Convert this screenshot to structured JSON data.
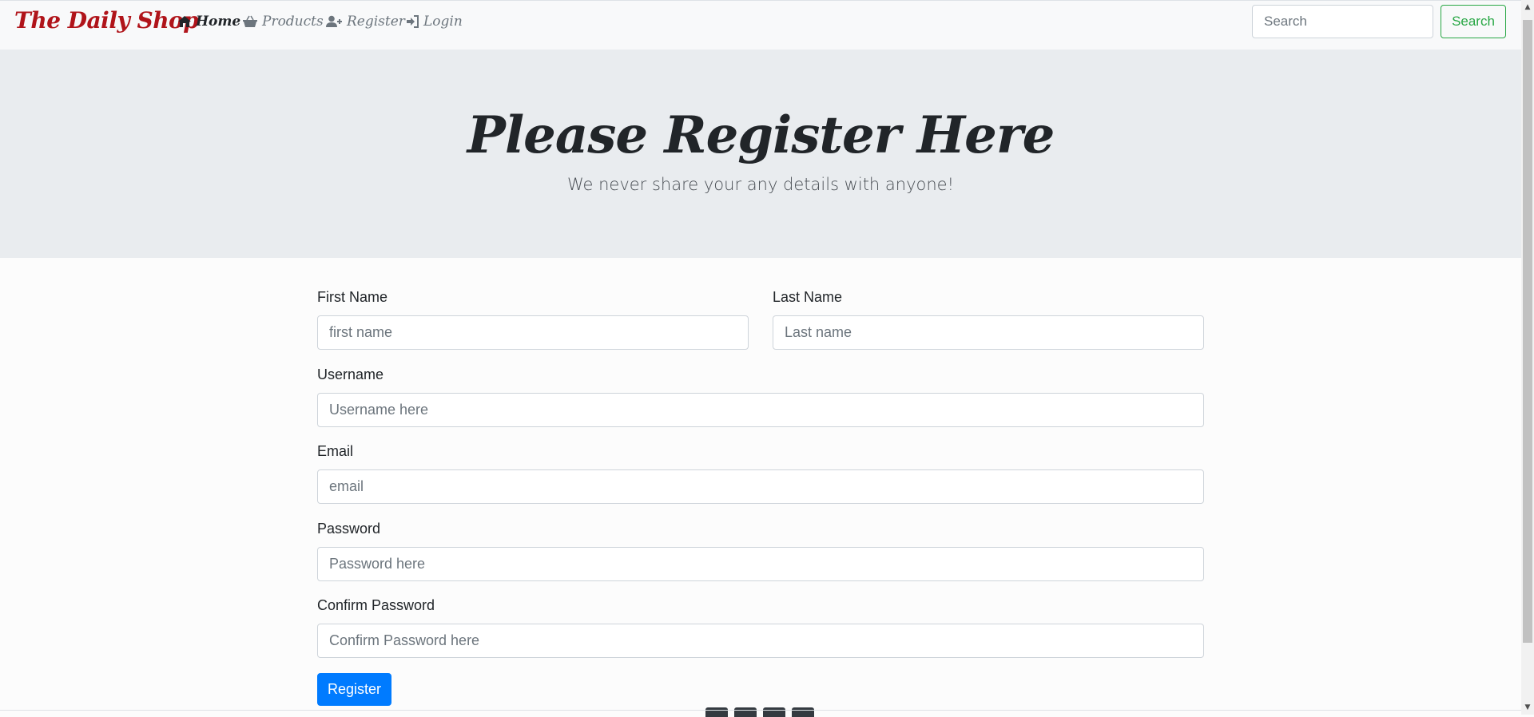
{
  "navbar": {
    "brand": "The Daily Shop",
    "items": [
      {
        "label": "Home",
        "icon": "home-icon",
        "active": true
      },
      {
        "label": "Products",
        "icon": "basket-icon",
        "active": false
      },
      {
        "label": "Register",
        "icon": "user-plus-icon",
        "active": false
      },
      {
        "label": "Login",
        "icon": "sign-in-icon",
        "active": false
      }
    ],
    "search_placeholder": "Search",
    "search_button": "Search"
  },
  "hero": {
    "title": "Please Register Here",
    "subtitle": "We never share your any details with anyone!"
  },
  "form": {
    "first_name": {
      "label": "First Name",
      "placeholder": "first name"
    },
    "last_name": {
      "label": "Last Name",
      "placeholder": "Last name"
    },
    "username": {
      "label": "Username",
      "placeholder": "Username here"
    },
    "email": {
      "label": "Email",
      "placeholder": "email"
    },
    "password": {
      "label": "Password",
      "placeholder": "Password here"
    },
    "confirm_password": {
      "label": "Confirm Password",
      "placeholder": "Confirm Password here"
    },
    "submit_label": "Register"
  },
  "colors": {
    "brand": "#b0141a",
    "primary": "#007bff",
    "success": "#28a745",
    "hero_bg": "#e9ecef"
  }
}
